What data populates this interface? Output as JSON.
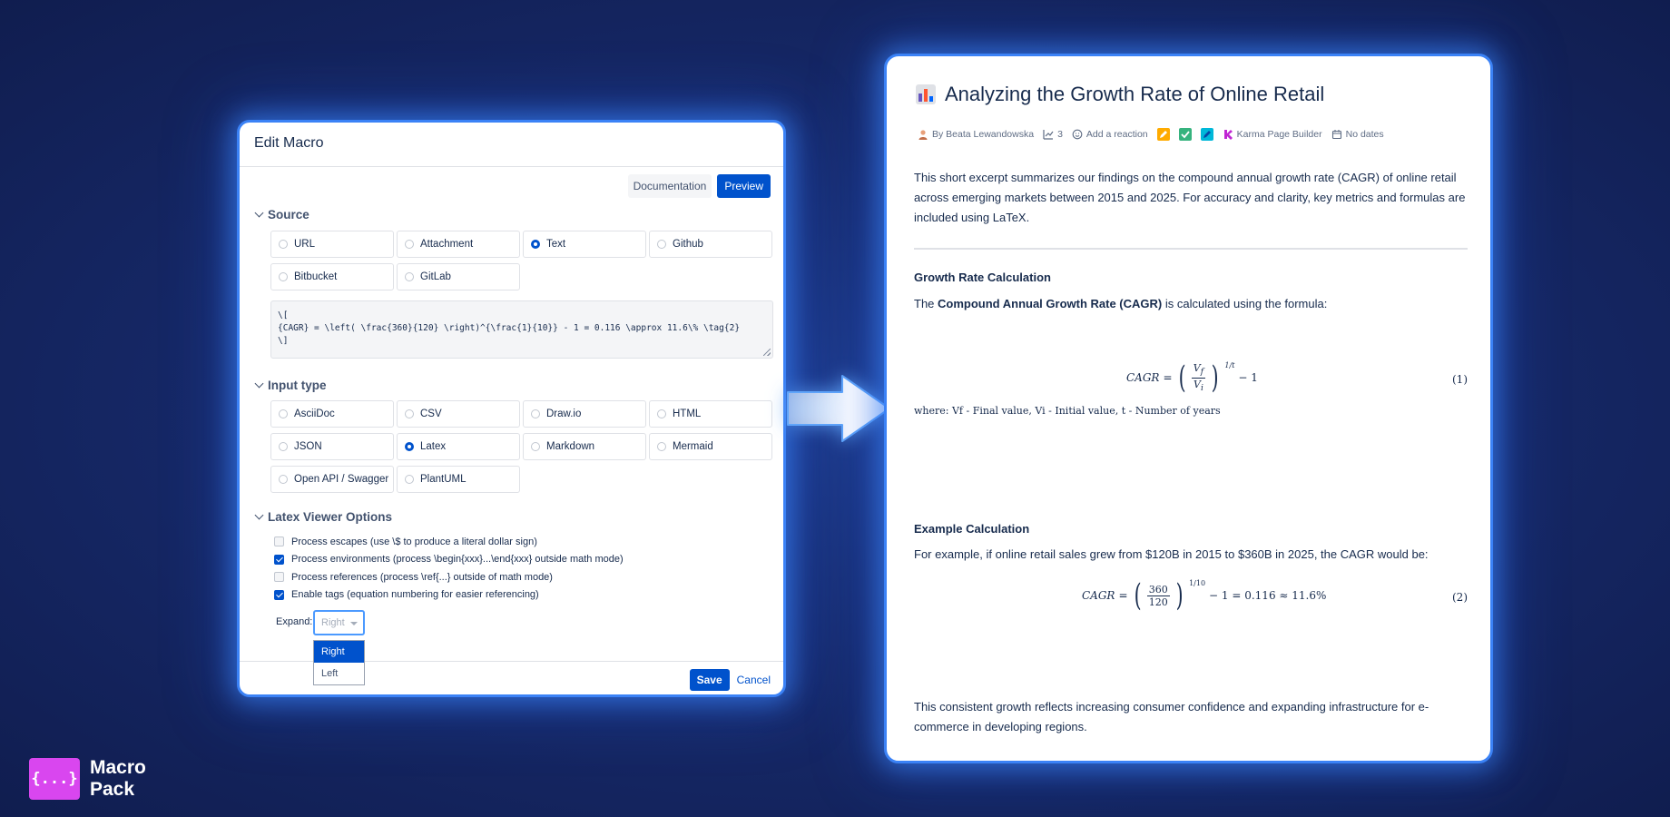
{
  "dialog": {
    "title": "Edit Macro",
    "documentation_label": "Documentation",
    "preview_label": "Preview",
    "source": {
      "title": "Source",
      "options": [
        {
          "label": "URL",
          "selected": false
        },
        {
          "label": "Attachment",
          "selected": false
        },
        {
          "label": "Text",
          "selected": true
        },
        {
          "label": "Github",
          "selected": false
        },
        {
          "label": "Bitbucket",
          "selected": false
        },
        {
          "label": "GitLab",
          "selected": false
        }
      ],
      "text_lines": [
        "\\[",
        "{CAGR} = \\left( \\frac{360}{120} \\right)^{\\frac{1}{10}} - 1 = 0.116 \\approx 11.6\\% \\tag{2}",
        "\\]"
      ]
    },
    "input_type": {
      "title": "Input type",
      "options": [
        {
          "label": "AsciiDoc",
          "selected": false
        },
        {
          "label": "CSV",
          "selected": false
        },
        {
          "label": "Draw.io",
          "selected": false
        },
        {
          "label": "HTML",
          "selected": false
        },
        {
          "label": "JSON",
          "selected": false
        },
        {
          "label": "Latex",
          "selected": true
        },
        {
          "label": "Markdown",
          "selected": false
        },
        {
          "label": "Mermaid",
          "selected": false
        },
        {
          "label": "Open API / Swagger",
          "selected": false
        },
        {
          "label": "PlantUML",
          "selected": false
        }
      ]
    },
    "latex_options": {
      "title": "Latex Viewer Options",
      "checks": [
        {
          "label": "Process escapes (use \\$ to produce a literal dollar sign)",
          "checked": false
        },
        {
          "label": "Process environments (process \\begin{xxx}...\\end{xxx} outside math mode)",
          "checked": true
        },
        {
          "label": "Process references (process \\ref{...} outside of math mode)",
          "checked": false
        },
        {
          "label": "Enable tags (equation numbering for easier referencing)",
          "checked": true
        }
      ],
      "expand_label": "Expand:",
      "expand_value": "Right",
      "expand_options": [
        "Right",
        "Left"
      ]
    },
    "save_label": "Save",
    "cancel_label": "Cancel"
  },
  "page": {
    "title": "Analyzing the Growth Rate of Online Retail",
    "meta": {
      "author": "By Beata Lewandowska",
      "views": "3",
      "reaction": "Add a reaction",
      "app": "Karma Page Builder",
      "dates": "No dates"
    },
    "intro": "This short excerpt summarizes our findings on the compound annual growth rate (CAGR) of online retail across emerging markets between 2015 and 2025. For accuracy and clarity, key metrics and formulas are included using LaTeX.",
    "section1_title": "Growth Rate Calculation",
    "formula_intro_prefix": "The ",
    "formula_intro_bold": "Compound Annual Growth Rate (CAGR)",
    "formula_intro_suffix": " is calculated using the formula:",
    "eq1_number": "(1)",
    "where_text": "where: Vf - Final value, Vi - Initial value, t - Number of years",
    "section2_title": "Example Calculation",
    "example_text": "For example, if online retail sales grew from $120B in 2015 to $360B in 2025, the CAGR would be:",
    "eq2_result": "− 1 = 0.116 ≈ 11.6%",
    "eq2_number": "(2)",
    "conclusion": "This consistent growth reflects increasing consumer confidence and expanding infrastructure for e-commerce in developing regions."
  },
  "logo": {
    "line1": "Macro",
    "line2": "Pack",
    "mark": "{...}"
  },
  "colors": {
    "accent": "#0052cc",
    "glow": "#3b82f6",
    "brand": "#d946ef"
  }
}
